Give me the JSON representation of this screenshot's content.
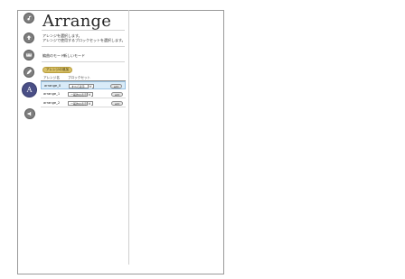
{
  "page": {
    "title": "Arrange",
    "description_line1": "アレンジを選択します。",
    "description_line2": "アレンジで使用するブロックセットを選択します。",
    "mode_label": "編曲のモード：",
    "mode_value": "新しいモード"
  },
  "nav": [
    {
      "name": "step-1",
      "icon": "music-note-icon",
      "active": false
    },
    {
      "name": "step-2",
      "icon": "upload-icon",
      "active": false
    },
    {
      "name": "step-3",
      "icon": "keyboard-icon",
      "active": false
    },
    {
      "name": "step-4",
      "icon": "pencil-icon",
      "active": false
    },
    {
      "name": "step-5",
      "icon": "arrange-a-icon",
      "active": true
    },
    {
      "name": "step-6",
      "icon": "volume-icon",
      "active": false
    }
  ],
  "actions": {
    "add_arrange": "アレンジの追加"
  },
  "table": {
    "headers": [
      "アレンジ名",
      "ブロックセット"
    ],
    "rows": [
      {
        "name": "arrange_0",
        "blockset": "すべて表示",
        "edit": "edit",
        "selected": true
      },
      {
        "name": "arrange_1",
        "blockset": "一般的な表示",
        "edit": "edit",
        "selected": false
      },
      {
        "name": "arrange_2",
        "blockset": "一般的な表示",
        "edit": "edit",
        "selected": false
      }
    ]
  },
  "colors": {
    "nav_circle": "#7e7e7e",
    "nav_active": "#4a4f86",
    "add_button": "#d8c066",
    "selected_row": "#d9ebf8"
  }
}
